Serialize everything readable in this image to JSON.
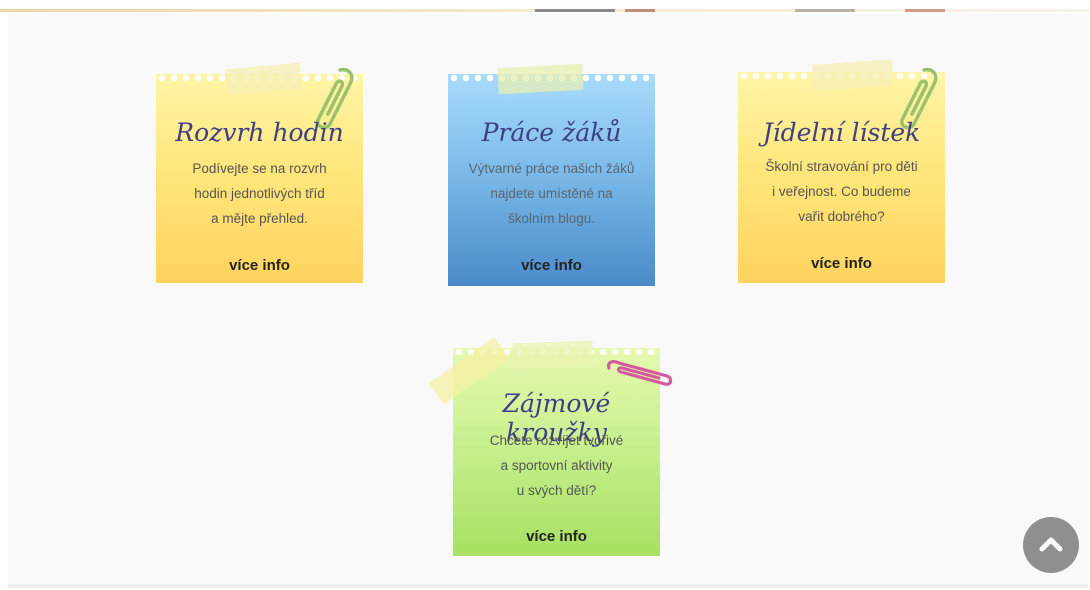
{
  "cards": [
    {
      "title": "Rozvrh hodin",
      "text": [
        "Podívejte se na rozvrh",
        "hodin jednotlivých tříd",
        "a mějte přehled."
      ],
      "link": "více info"
    },
    {
      "title": "Práce žáků",
      "text": [
        "Výtvarné práce našich žáků",
        "najdete umístěné na",
        "školním blogu."
      ],
      "link": "více info"
    },
    {
      "title": "Jídelní lístek",
      "text": [
        "Školní stravování pro děti",
        "i veřejnost. Co budeme",
        "vařit dobrého?"
      ],
      "link": "více info"
    },
    {
      "title": "Zájmové kroužky",
      "text": [
        "Chcete rozvíjet tvořivé",
        "a sportovní aktivity",
        "u svých dětí?"
      ],
      "link": "více info"
    }
  ],
  "colors": {
    "yellow_note": "#ffe77d",
    "blue_note": "#7cbbea",
    "green_note": "#c8f08f",
    "title_color": "#3f3f86",
    "scroll_button": "#8f8f8f"
  },
  "icons": {
    "scroll_top": "chevron-up-icon",
    "clip": "paperclip-icon"
  }
}
